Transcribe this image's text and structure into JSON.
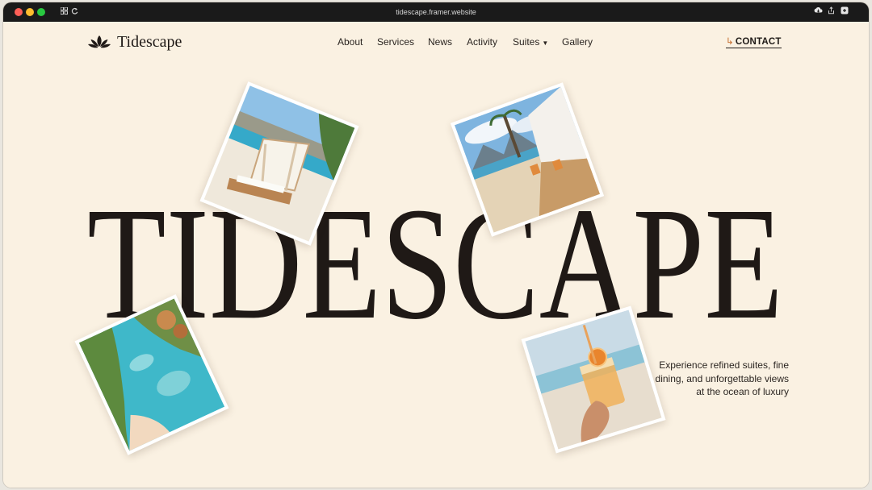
{
  "browser": {
    "url": "tidescape.framer.website",
    "icons": [
      "sidebar-grid-icon",
      "reload-icon",
      "download-icon",
      "share-icon",
      "extension-icon"
    ]
  },
  "header": {
    "logo_text": "Tidescape",
    "nav": [
      {
        "label": "About"
      },
      {
        "label": "Services"
      },
      {
        "label": "News"
      },
      {
        "label": "Activity"
      },
      {
        "label": "Suites"
      },
      {
        "label": "Gallery"
      }
    ],
    "contact_label": "CONTACT",
    "contact_arrow": "↳"
  },
  "hero": {
    "title": "TIDESCAPE",
    "tagline_lines": [
      "Experience refined suites, fine",
      "dining, and unforgettable views",
      "at the ocean of luxury"
    ]
  },
  "colors": {
    "background": "#faf1e2",
    "text": "#1f1916",
    "accent": "#c46a2a"
  }
}
